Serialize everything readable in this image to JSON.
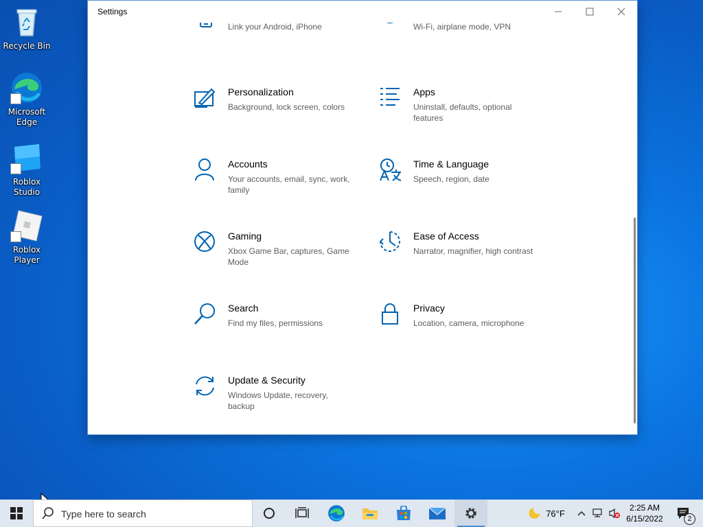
{
  "desktop": {
    "icons": [
      {
        "label": "Recycle Bin"
      },
      {
        "label": "Microsoft Edge"
      },
      {
        "label": "Roblox Studio"
      },
      {
        "label": "Roblox Player"
      }
    ]
  },
  "window": {
    "title": "Settings",
    "accent": "#0063b1",
    "tiles": [
      {
        "title": "",
        "desc": "Link your Android, iPhone",
        "icon": "phone-icon"
      },
      {
        "title": "",
        "desc": "Wi-Fi, airplane mode, VPN",
        "icon": "globe-icon"
      },
      {
        "title": "Personalization",
        "desc": "Background, lock screen, colors",
        "icon": "personalization-icon"
      },
      {
        "title": "Apps",
        "desc": "Uninstall, defaults, optional features",
        "icon": "apps-icon"
      },
      {
        "title": "Accounts",
        "desc": "Your accounts, email, sync, work, family",
        "icon": "person-icon"
      },
      {
        "title": "Time & Language",
        "desc": "Speech, region, date",
        "icon": "time-language-icon"
      },
      {
        "title": "Gaming",
        "desc": "Xbox Game Bar, captures, Game Mode",
        "icon": "xbox-icon"
      },
      {
        "title": "Ease of Access",
        "desc": "Narrator, magnifier, high contrast",
        "icon": "ease-of-access-icon"
      },
      {
        "title": "Search",
        "desc": "Find my files, permissions",
        "icon": "search-icon"
      },
      {
        "title": "Privacy",
        "desc": "Location, camera, microphone",
        "icon": "lock-icon"
      },
      {
        "title": "Update & Security",
        "desc": "Windows Update, recovery, backup",
        "icon": "update-icon"
      }
    ]
  },
  "taskbar": {
    "search_placeholder": "Type here to search",
    "weather": "76°F",
    "time": "2:25 AM",
    "date": "6/15/2022",
    "notifications": "2"
  }
}
